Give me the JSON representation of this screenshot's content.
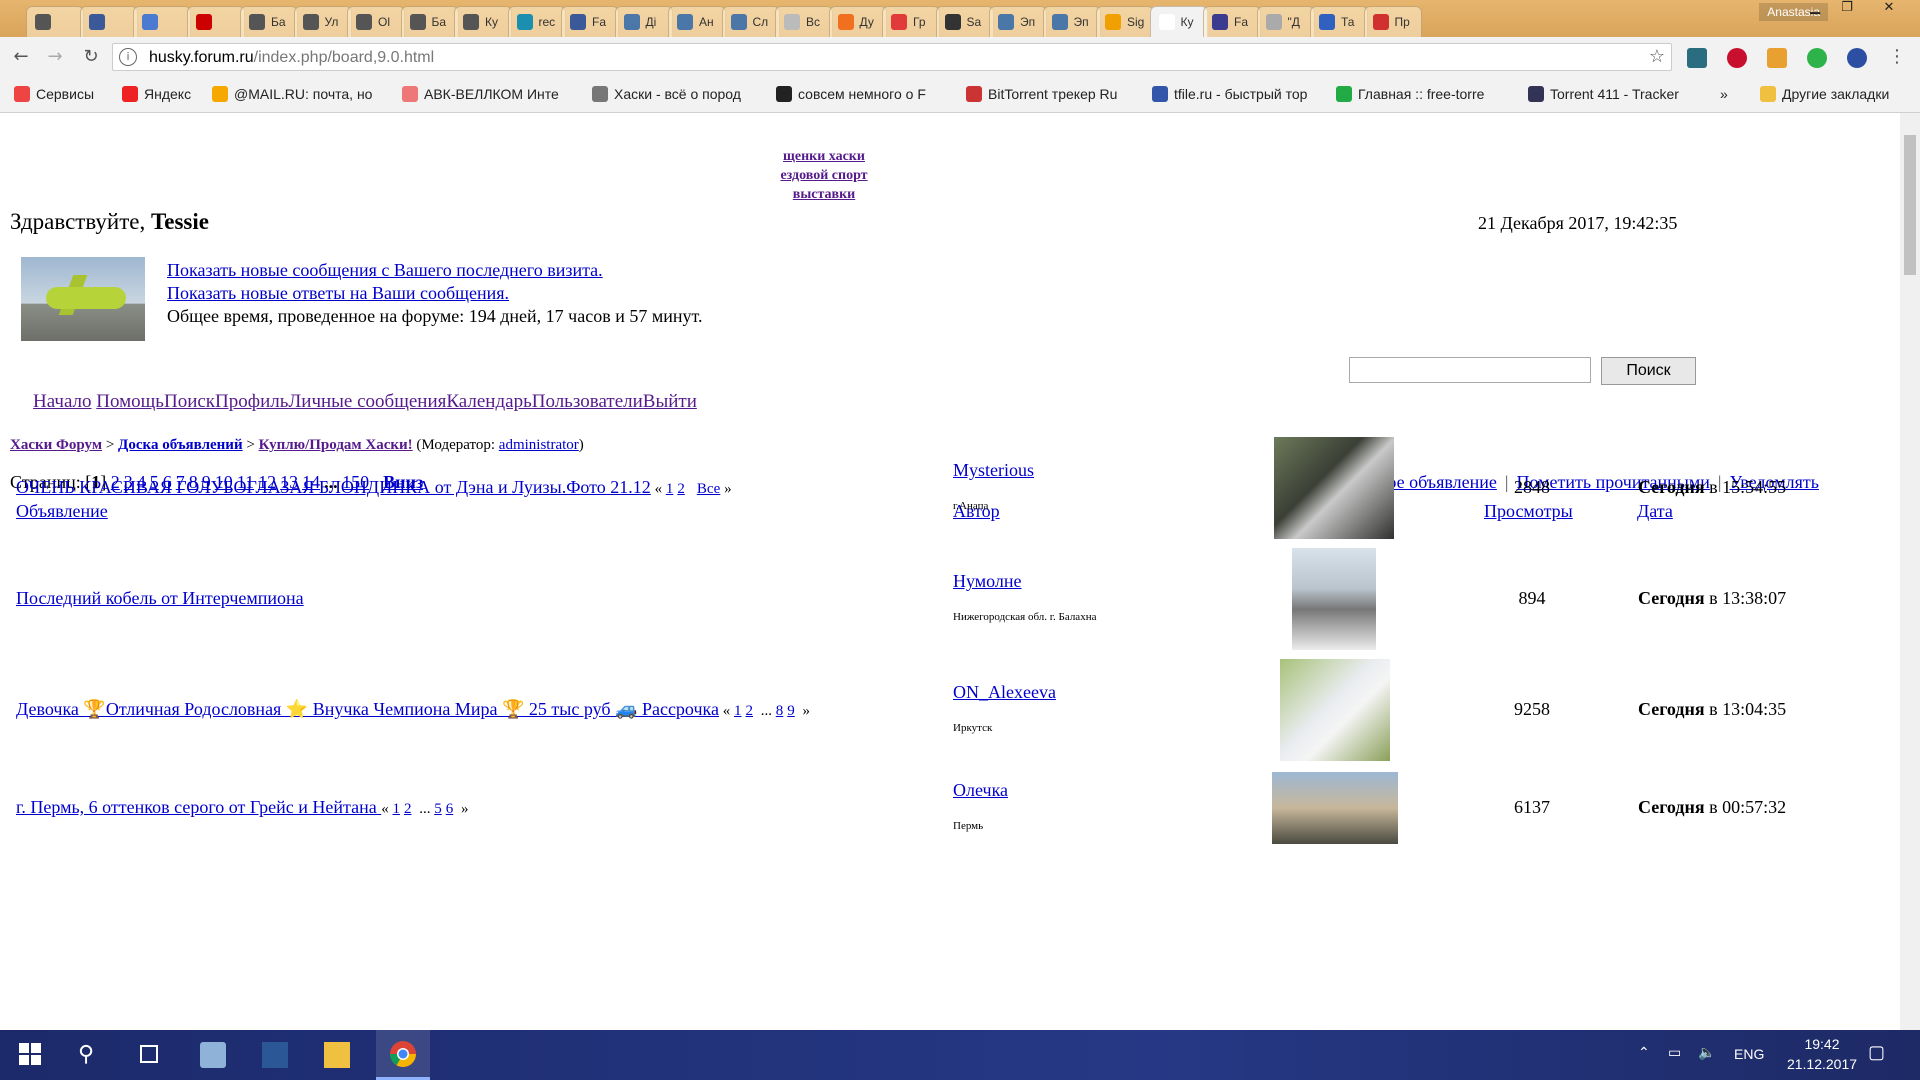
{
  "browser": {
    "tabs": [
      {
        "label": ""
      },
      {
        "label": ""
      },
      {
        "label": ""
      },
      {
        "label": ""
      },
      {
        "label": "Ба"
      },
      {
        "label": "Ул"
      },
      {
        "label": "Ol"
      },
      {
        "label": "Ба"
      },
      {
        "label": "Ку"
      },
      {
        "label": "rec"
      },
      {
        "label": "Fa"
      },
      {
        "label": "Ді"
      },
      {
        "label": "Ан"
      },
      {
        "label": "Сл"
      },
      {
        "label": "Вс"
      },
      {
        "label": "Ду"
      },
      {
        "label": "Гр"
      },
      {
        "label": "Sa"
      },
      {
        "label": "Эп"
      },
      {
        "label": "Эп"
      },
      {
        "label": "Sig"
      },
      {
        "label": "Ку"
      },
      {
        "label": "Fa"
      },
      {
        "label": "\"Д"
      },
      {
        "label": "Та"
      },
      {
        "label": "Пр"
      }
    ],
    "profile": "Anastasia",
    "url_host": "husky.forum.ru",
    "url_path": "/index.php/board,9.0.html",
    "bookmarks": [
      {
        "label": "Сервисы"
      },
      {
        "label": "Яндекс"
      },
      {
        "label": "@MAIL.RU: почта, но"
      },
      {
        "label": "АВК-ВЕЛЛКОМ Инте"
      },
      {
        "label": "Хаски - всё о пород"
      },
      {
        "label": "совсем немного о F"
      },
      {
        "label": "BitTorrent трекер Ru"
      },
      {
        "label": "tfile.ru - быстрый тор"
      },
      {
        "label": "Главная :: free-torre"
      },
      {
        "label": "Torrent 411 - Tracker"
      }
    ],
    "bookmarks_more": "»",
    "other_bookmarks": "Другие закладки"
  },
  "forum": {
    "top_menu": [
      "щенки хаски",
      "ездовой спорт",
      "выставки"
    ],
    "greeting_prefix": "Здравствуйте, ",
    "username": "Tessie",
    "datetime": "21 Декабря 2017, 19:42:35",
    "user_links": [
      "Показать новые сообщения с Вашего последнего визита.",
      "Показать новые ответы на Ваши сообщения."
    ],
    "total_time": "Общее время, проведенное на форуме: 194 дней, 17 часов и 57 минут.",
    "search_button": "Поиск",
    "main_nav": [
      "Начало",
      "Помощь",
      "Поиск",
      "Профиль",
      "Личные сообщения",
      "Календарь",
      "Пользователи",
      "Выйти"
    ],
    "breadcrumb": {
      "root": "Хаски Форум",
      "sep": " > ",
      "board": "Доска объявлений",
      "sub": "Куплю/Продам Хаски!",
      "moderator_prefix": " (Модератор: ",
      "moderator": "administrator",
      "moderator_suffix": ")"
    },
    "pages_label": "Страниц: [",
    "current_page": "1",
    "pages_close": "] ",
    "page_links": [
      "2",
      "3",
      "4",
      "5",
      "6",
      "7",
      "8",
      "9",
      "10",
      "11",
      "12",
      "13",
      "14"
    ],
    "pages_ellipsis": "...",
    "last_page": "150",
    "down_link": "Вниз",
    "actions": [
      "Новое объявление",
      "Пометить прочитанными",
      "Уведомлять"
    ],
    "columns": {
      "topic": "Объявление",
      "author": "Автор",
      "views": "Просмотры",
      "date": "Дата"
    },
    "rows": [
      {
        "title": "ОЧЕНЬ КРАСИВАЯ ГОЛУБОГЛАЗАЯ БЛОНДИНКА от Дэна и Луизы.Фото 21.12",
        "pages_open": " « ",
        "pages": [
          "1",
          "2"
        ],
        "pages_mid": "",
        "pages_all": "Все",
        "pages_close": " »",
        "author": "Mysterious",
        "city": "г.Анапа",
        "views": "2848",
        "date_bold": "Сегодня",
        "date_rest": " в 15:54:55"
      },
      {
        "title": "Последний кобель от Интерчемпиона",
        "pages_open": "",
        "pages": [],
        "pages_mid": "",
        "pages_all": "",
        "pages_close": "",
        "author": "Нумолне",
        "city": "Нижегородская обл. г. Балахна",
        "views": "894",
        "date_bold": "Сегодня",
        "date_rest": " в 13:38:07"
      },
      {
        "title": "Девочка 🏆Отличная Родословная ⭐ Внучка Чемпиона Мира 🏆 25 тыс руб 🚙 Рассрочка",
        "pages_open": " « ",
        "pages": [
          "1",
          "2"
        ],
        "pages_mid": " ... ",
        "pages_tail": [
          "8",
          "9"
        ],
        "pages_all": "",
        "pages_close": " »",
        "author": "ON_Alexeeva",
        "city": "Иркутск",
        "views": "9258",
        "date_bold": "Сегодня",
        "date_rest": " в 13:04:35"
      },
      {
        "title": "г. Пермь, 6 оттенков серого от Грейс и Нейтана ",
        "pages_open": "« ",
        "pages": [
          "1",
          "2"
        ],
        "pages_mid": " ... ",
        "pages_tail": [
          "5",
          "6"
        ],
        "pages_all": "",
        "pages_close": " »",
        "author": "Олечка",
        "city": "Пермь",
        "views": "6137",
        "date_bold": "Сегодня",
        "date_rest": " в 00:57:32"
      }
    ]
  },
  "taskbar": {
    "lang": "ENG",
    "time": "19:42",
    "date": "21.12.2017"
  },
  "colors": {
    "link": "#0000cc",
    "visited": "#551a8b",
    "taskbar": "#1c2a6b",
    "tabstrip": "#e6b56e"
  }
}
